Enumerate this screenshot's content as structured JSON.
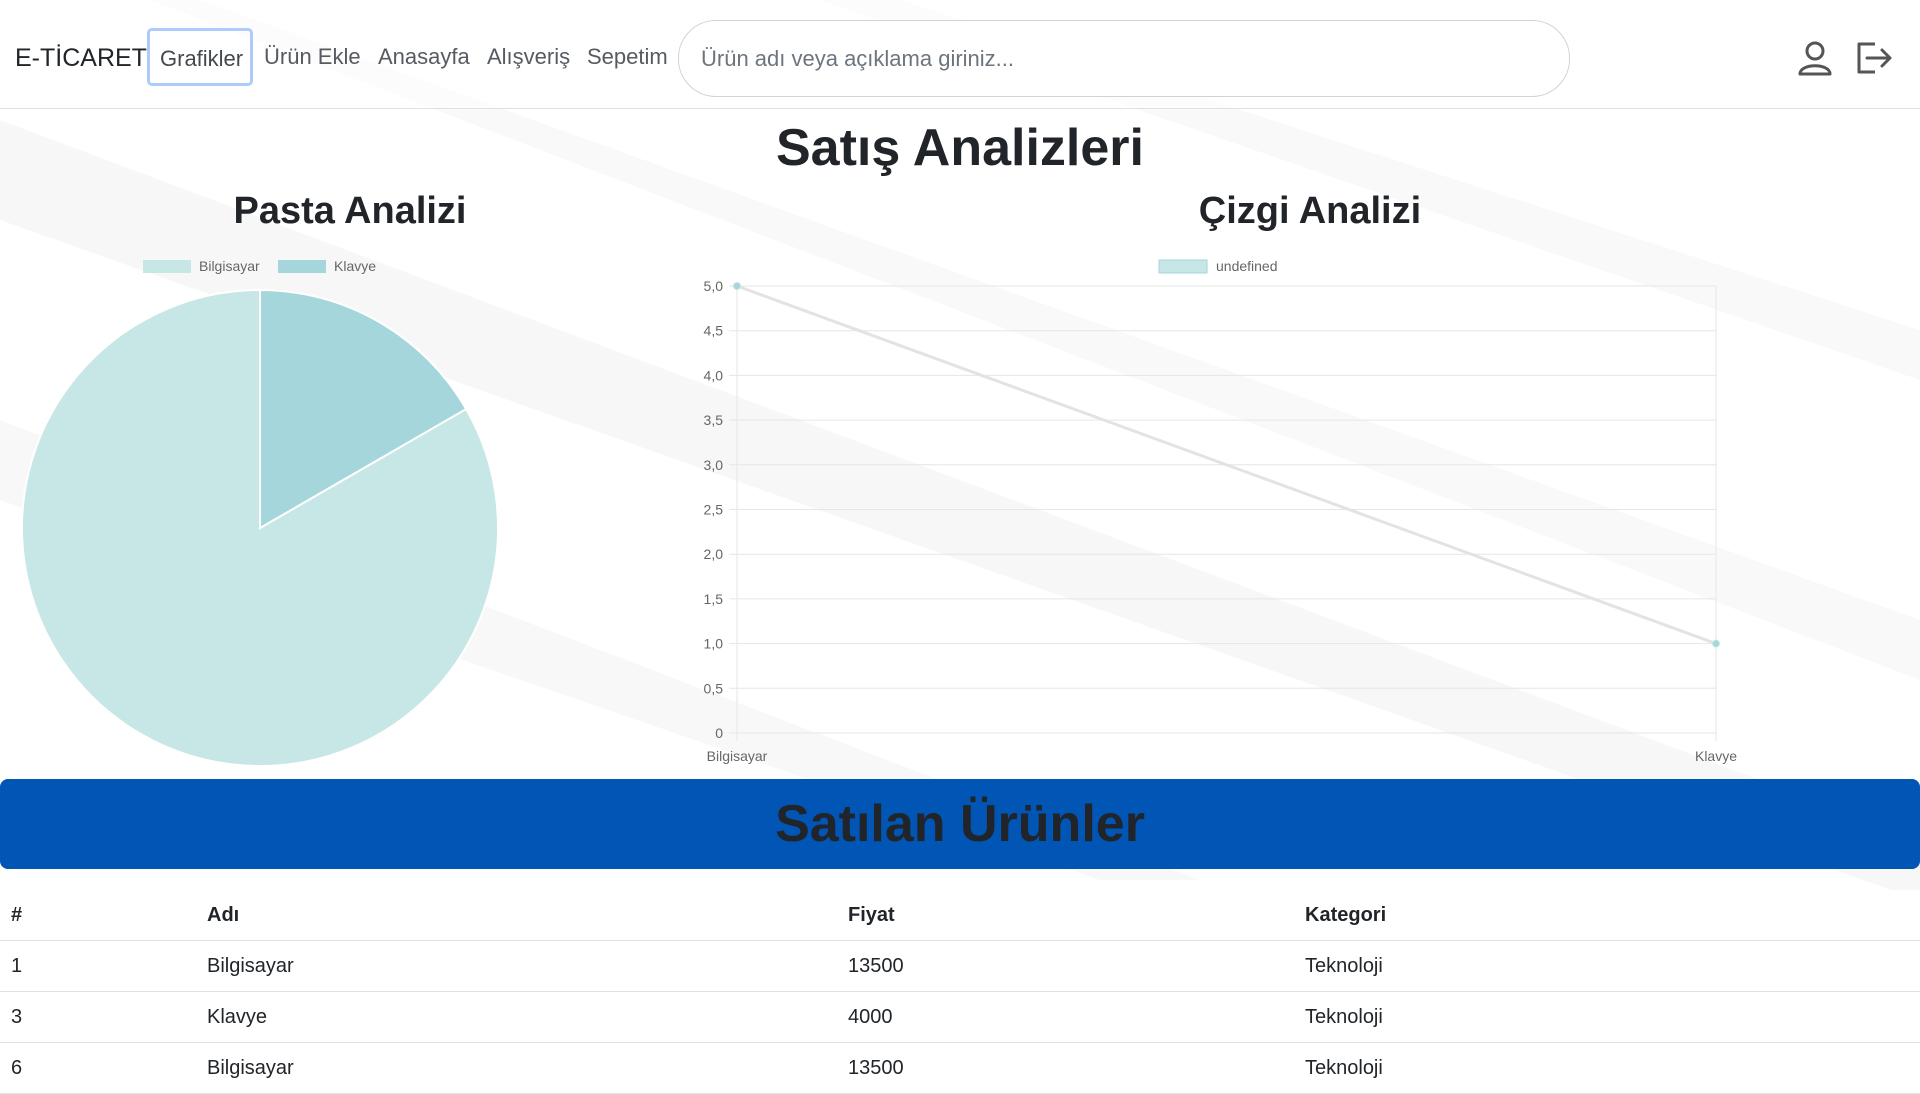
{
  "navbar": {
    "brand": "E-TİCARET",
    "links": [
      "Grafikler",
      "Ürün Ekle",
      "Anasayfa",
      "Alışveriş",
      "Sepetim"
    ],
    "search_placeholder": "Ürün adı veya açıklama giriniz...",
    "icons": [
      "user-icon",
      "logout-icon"
    ]
  },
  "page": {
    "title": "Satış Analizleri",
    "pie_title": "Pasta Analizi",
    "line_title": "Çizgi Analizi"
  },
  "chart_data": [
    {
      "type": "pie",
      "title": "Pasta Analizi",
      "labels": [
        "Bilgisayar",
        "Klavye"
      ],
      "values": [
        5,
        1
      ],
      "colors": [
        "#c7e6e6",
        "#a4d6dc"
      ],
      "legend": "top"
    },
    {
      "type": "line",
      "title": "Çizgi Analizi",
      "categories": [
        "Bilgisayar",
        "Klavye"
      ],
      "series": [
        {
          "name": "undefined",
          "values": [
            5,
            1
          ]
        }
      ],
      "ylim": [
        0,
        5
      ],
      "yticks": [
        "0",
        "0,5",
        "1,0",
        "1,5",
        "2,0",
        "2,5",
        "3,0",
        "3,5",
        "4,0",
        "4,5",
        "5,0"
      ],
      "grid": true,
      "legend": "top"
    }
  ],
  "sold": {
    "title": "Satılan Ürünler",
    "columns": [
      "#",
      "Adı",
      "Fiyat",
      "Kategori"
    ],
    "rows": [
      [
        "1",
        "Bilgisayar",
        "13500",
        "Teknoloji"
      ],
      [
        "3",
        "Klavye",
        "4000",
        "Teknoloji"
      ],
      [
        "6",
        "Bilgisayar",
        "13500",
        "Teknoloji"
      ]
    ]
  },
  "colors": {
    "banner": "#0055b5",
    "pie_bilgisayar": "#c7e6e6",
    "pie_klavye": "#a4d6dc",
    "line": "#e3e3e3",
    "point": "#a4d6dc"
  }
}
